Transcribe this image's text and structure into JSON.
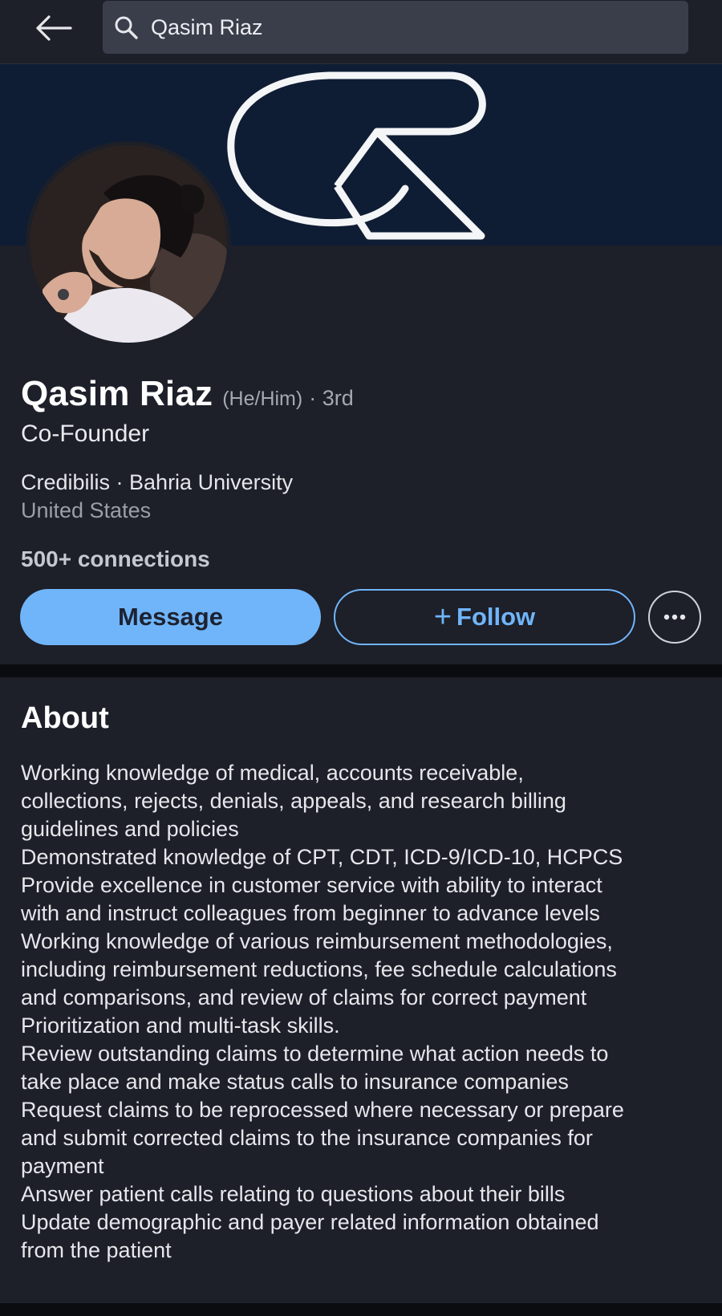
{
  "search": {
    "value": "Qasim Riaz"
  },
  "banner": {
    "logo_text": "QR"
  },
  "profile": {
    "name": "Qasim Riaz",
    "pronouns": "(He/Him)",
    "degree": "· 3rd",
    "headline": "Co-Founder",
    "company_school": "Credibilis · Bahria University",
    "location": "United States",
    "connections": "500+ connections"
  },
  "actions": {
    "message_label": "Message",
    "follow_plus": "+",
    "follow_label": "Follow",
    "more_icon": "more-horizontal-icon"
  },
  "about": {
    "title": "About",
    "lines": [
      "Working knowledge of medical, accounts receivable,",
      "collections, rejects, denials, appeals, and research billing",
      "guidelines and policies",
      "Demonstrated knowledge of CPT, CDT, ICD-9/ICD-10, HCPCS",
      "Provide excellence in customer service with ability to interact",
      "with and instruct colleagues from beginner to advance levels",
      "Working knowledge of various reimbursement methodologies,",
      "including reimbursement reductions, fee schedule calculations",
      "and comparisons, and review of claims for correct payment",
      "Prioritization and multi-task skills.",
      "Review outstanding claims to determine what action needs to",
      "take place and make status calls to insurance companies",
      "Request claims to be reprocessed where necessary or prepare",
      "and submit corrected claims to the insurance companies for",
      "payment",
      "Answer patient calls relating to questions about their bills",
      "Update demographic and payer related information obtained",
      "from the patient"
    ]
  },
  "colors": {
    "background": "#1d1f29",
    "accent": "#70b5f9",
    "banner": "#0e1d33"
  }
}
